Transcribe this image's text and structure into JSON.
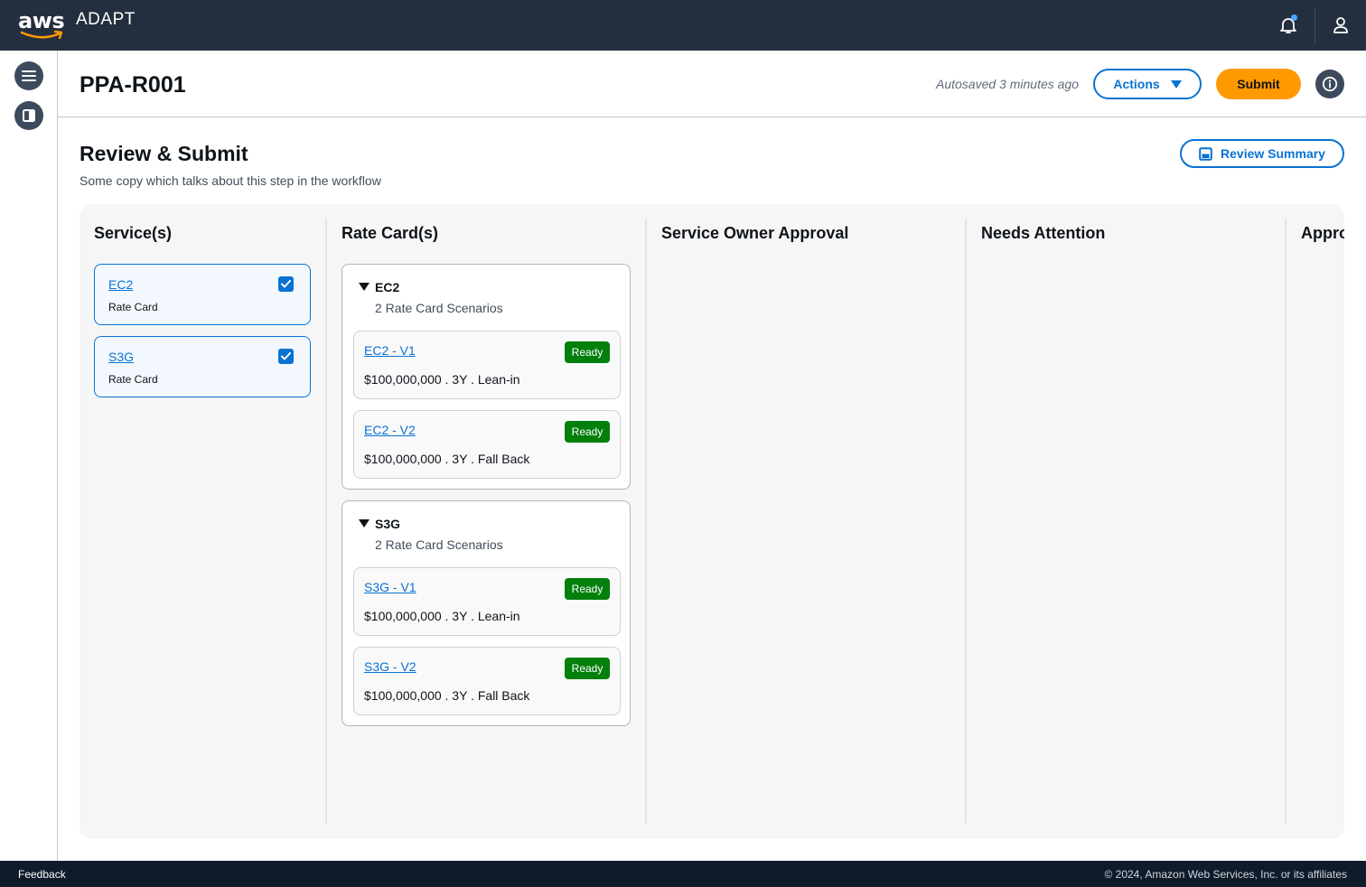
{
  "topnav": {
    "logo_text": "aws",
    "app_name": "ADAPT",
    "icons": {
      "notifications": "bell-icon",
      "profile": "user-icon"
    }
  },
  "rail": {
    "icons": [
      "hamburger-menu-icon",
      "side-panel-icon"
    ]
  },
  "header": {
    "title": "PPA-R001",
    "autosave": "Autosaved 3 minutes ago",
    "actions_label": "Actions",
    "submit_label": "Submit"
  },
  "section": {
    "title": "Review & Submit",
    "description": "Some copy which talks about this step in the workflow",
    "review_summary_label": "Review Summary"
  },
  "columns": {
    "services": "Service(s)",
    "rate_cards": "Rate Card(s)",
    "service_owner_approval": "Service Owner Approval",
    "needs_attention": "Needs Attention",
    "approved": "Appro"
  },
  "services": [
    {
      "name": "EC2",
      "type": "Rate Card",
      "checked": true
    },
    {
      "name": "S3G",
      "type": "Rate Card",
      "checked": true
    }
  ],
  "rate_card_groups": [
    {
      "name": "EC2",
      "count_label": "2 Rate Card Scenarios",
      "scenarios": [
        {
          "name": "EC2 - V1",
          "status": "Ready",
          "detail": "$100,000,000 . 3Y . Lean-in"
        },
        {
          "name": "EC2 - V2",
          "status": "Ready",
          "detail": "$100,000,000 . 3Y . Fall Back"
        }
      ]
    },
    {
      "name": "S3G",
      "count_label": "2 Rate Card Scenarios",
      "scenarios": [
        {
          "name": "S3G - V1",
          "status": "Ready",
          "detail": "$100,000,000 . 3Y . Lean-in"
        },
        {
          "name": "S3G - V2",
          "status": "Ready",
          "detail": "$100,000,000 . 3Y . Fall Back"
        }
      ]
    }
  ],
  "footer": {
    "feedback": "Feedback",
    "copyright": "© 2024, Amazon Web Services, Inc. or its affiliates"
  },
  "colors": {
    "nav_bg": "#232f3e",
    "link": "#0972d3",
    "primary": "#ff9900",
    "success": "#037f0c",
    "footer_bg": "#0f1b2a"
  }
}
